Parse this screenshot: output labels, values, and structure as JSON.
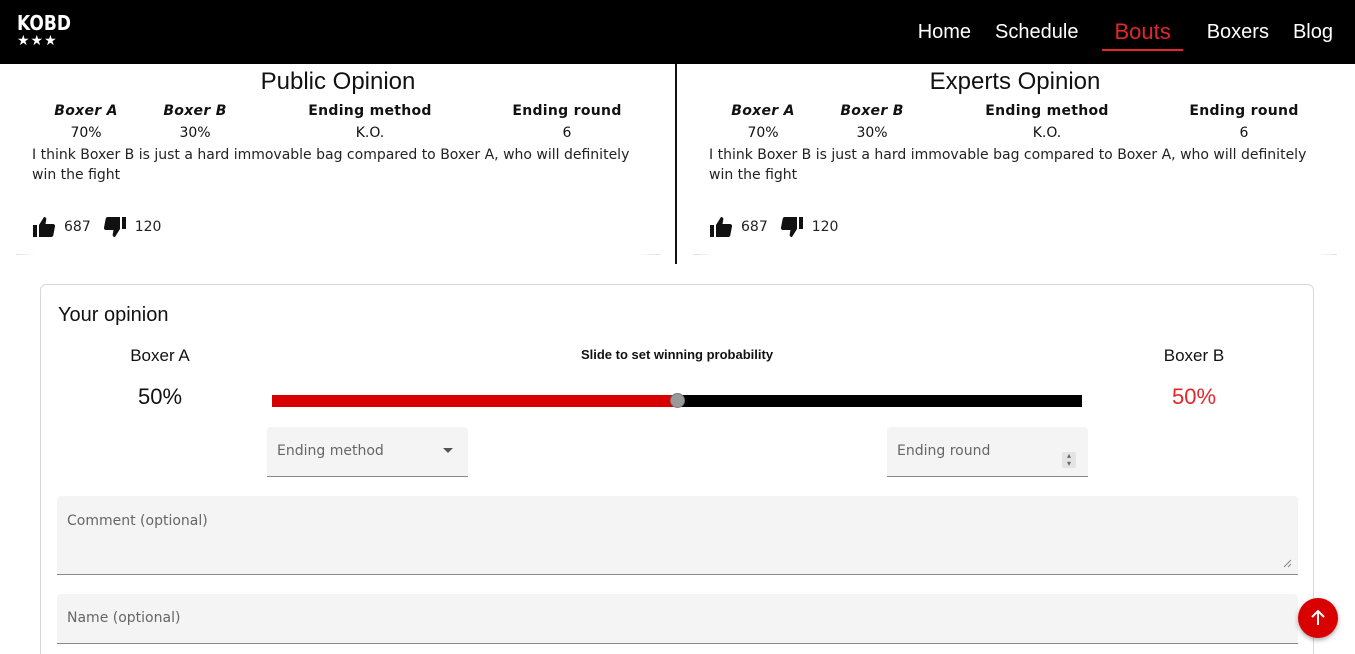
{
  "header": {
    "logo_text": "KOBD",
    "logo_stars": "★★★",
    "nav": [
      {
        "label": "Home",
        "active": false
      },
      {
        "label": "Schedule",
        "active": false
      },
      {
        "label": "Bouts",
        "active": true
      },
      {
        "label": "Boxers",
        "active": false
      },
      {
        "label": "Blog",
        "active": false
      }
    ]
  },
  "public_opinion": {
    "title": "Public Opinion",
    "headers": [
      "Boxer A",
      "Boxer B",
      "Ending method",
      "Ending round"
    ],
    "values": [
      "70%",
      "30%",
      "K.O.",
      "6"
    ],
    "comment": "I think Boxer B is just a hard immovable bag compared to Boxer A, who will definitely win the fight",
    "likes": "687",
    "dislikes": "120",
    "like_icon": "thumbs-up-icon",
    "dislike_icon": "thumbs-down-icon"
  },
  "experts_opinion": {
    "title": "Experts Opinion",
    "headers": [
      "Boxer A",
      "Boxer B",
      "Ending method",
      "Ending round"
    ],
    "values": [
      "70%",
      "30%",
      "K.O.",
      "6"
    ],
    "comment": "I think Boxer B is just a hard immovable bag compared to Boxer A, who will definitely win the fight",
    "likes": "687",
    "dislikes": "120",
    "like_icon": "thumbs-up-icon",
    "dislike_icon": "thumbs-down-icon"
  },
  "your_opinion": {
    "title": "Your opinion",
    "boxer_a_label": "Boxer A",
    "boxer_b_label": "Boxer B",
    "boxer_a_pct": "50%",
    "boxer_b_pct": "50%",
    "slider_hint": "Slide to set winning probability",
    "slider_value": 0.5,
    "ending_method_label": "Ending method",
    "ending_round_label": "Ending round",
    "comment_label": "Comment (optional)",
    "name_label": "Name (optional)"
  },
  "scroll_top_icon": "arrow-up-icon",
  "colors": {
    "accent": "#e3262b",
    "slider_fill": "#d80000",
    "header_bg": "#000000"
  }
}
